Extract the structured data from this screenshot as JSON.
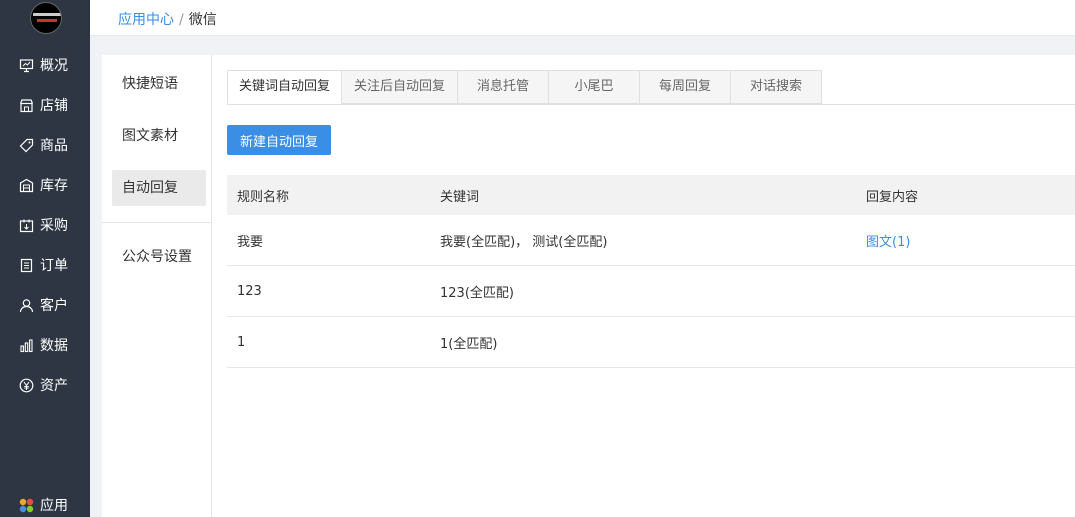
{
  "nav": {
    "items": [
      {
        "label": "概况",
        "icon": "monitor-icon"
      },
      {
        "label": "店铺",
        "icon": "store-icon"
      },
      {
        "label": "商品",
        "icon": "tag-icon"
      },
      {
        "label": "库存",
        "icon": "inventory-icon"
      },
      {
        "label": "采购",
        "icon": "purchase-icon"
      },
      {
        "label": "订单",
        "icon": "order-icon"
      },
      {
        "label": "客户",
        "icon": "user-icon"
      },
      {
        "label": "数据",
        "icon": "bar-chart-icon"
      },
      {
        "label": "资产",
        "icon": "yen-icon"
      }
    ],
    "apps": {
      "label": "应用",
      "icon": "apps-icon"
    }
  },
  "breadcrumb": {
    "parent": "应用中心",
    "separator": "/",
    "current": "微信"
  },
  "submenu": {
    "items": [
      "快捷短语",
      "图文素材",
      "自动回复",
      "公众号设置"
    ],
    "active_index": 2
  },
  "tabs": [
    "关键词自动回复",
    "关注后自动回复",
    "消息托管",
    "小尾巴",
    "每周回复",
    "对话搜索"
  ],
  "active_tab": 0,
  "new_button": "新建自动回复",
  "table": {
    "headers": [
      "规则名称",
      "关键词",
      "回复内容"
    ],
    "rows": [
      {
        "name": "我要",
        "keywords": "我要(全匹配)， 测试(全匹配)",
        "reply": "图文(1)"
      },
      {
        "name": "123",
        "keywords": "123(全匹配)",
        "reply": ""
      },
      {
        "name": "1",
        "keywords": "1(全匹配)",
        "reply": ""
      }
    ]
  },
  "colors": {
    "nav_bg": "#2d3642",
    "accent": "#3a8ee6"
  }
}
